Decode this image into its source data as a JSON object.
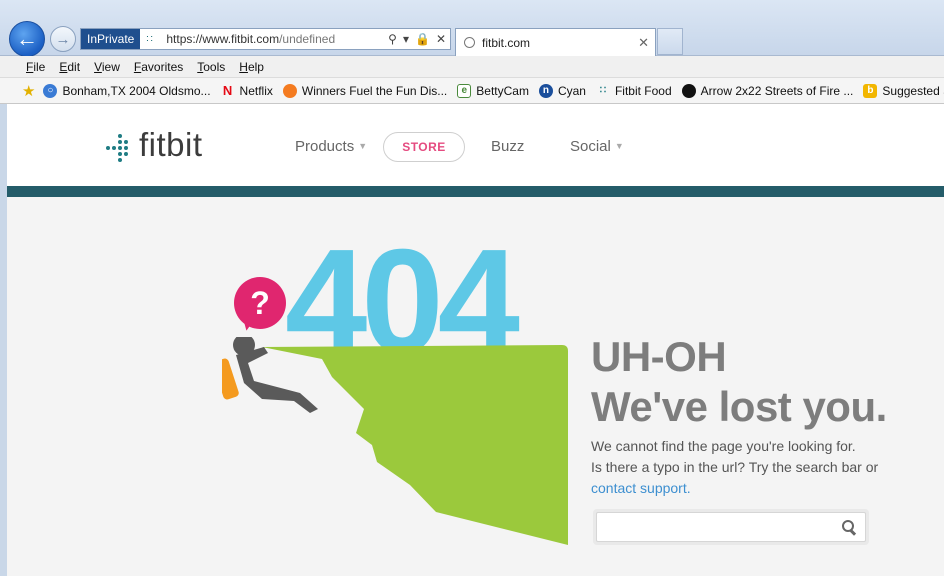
{
  "browser": {
    "inprivate": "InPrivate",
    "url_host": "https://www.fitbit.com",
    "url_path": "/undefined",
    "tab_title": "fitbit.com",
    "menu": [
      "File",
      "Edit",
      "View",
      "Favorites",
      "Tools",
      "Help"
    ],
    "favorites": [
      {
        "icon": "globe-icon",
        "label": "Bonham,TX 2004 Oldsmo...",
        "color": "#3a7bd5"
      },
      {
        "icon": "netflix-icon",
        "label": "Netflix",
        "color": "#e50914"
      },
      {
        "icon": "circle-icon",
        "label": "Winners  Fuel the Fun  Dis...",
        "color": "#f47b20"
      },
      {
        "icon": "page-icon",
        "label": "BettyCam",
        "color": "#4a8a3c"
      },
      {
        "icon": "n-icon",
        "label": "Cyan",
        "color": "#1b4f9c"
      },
      {
        "icon": "fitbit-icon",
        "label": "Fitbit Food",
        "color": "#1f7c83"
      },
      {
        "icon": "disc-icon",
        "label": "Arrow 2x22 Streets of Fire ...",
        "color": "#111111"
      },
      {
        "icon": "bing-icon",
        "label": "Suggested Sit",
        "color": "#f2b600"
      }
    ]
  },
  "site": {
    "logo": "fitbit",
    "nav": {
      "products": "Products",
      "store": "STORE",
      "buzz": "Buzz",
      "social": "Social"
    },
    "error": {
      "code": "404",
      "bubble": "?",
      "headline1": "UH-OH",
      "headline2": "We've lost you.",
      "line1": "We cannot find the page you're looking for.",
      "line2": "Is there a typo in the url? Try the search bar or",
      "link": "contact support.",
      "search_placeholder": ""
    },
    "colors": {
      "accent": "#5ec8e6",
      "store": "#e54b80",
      "cliff": "#9bc93c",
      "rule": "#245c69"
    }
  }
}
